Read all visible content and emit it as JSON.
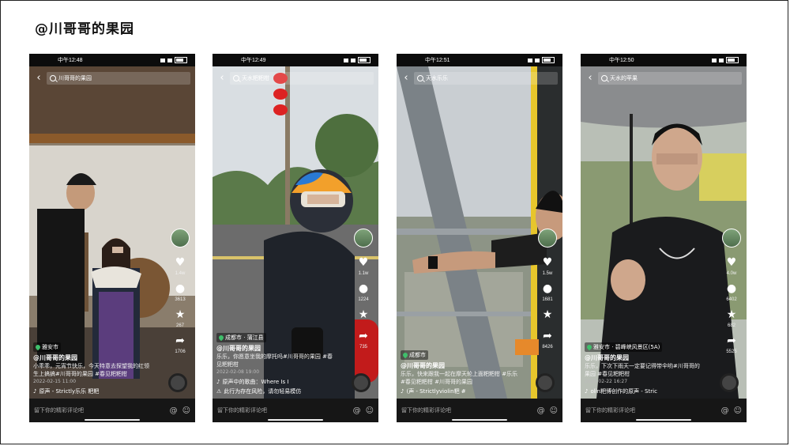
{
  "slide": {
    "title": "@川哥哥的果园"
  },
  "phones": [
    {
      "time": "中午12:48",
      "search": "川哥哥的果园",
      "sidebar": {
        "likes": "1.4w",
        "comments": "3613",
        "favorites": "267",
        "shares": "1706"
      },
      "location": "雅安市",
      "author": "@川哥哥的果园",
      "caption": "小乖乖，元宵节快乐，今天特意去探望我的红领生上搞搞#川哥哥的果园 #春见粑粑柑",
      "date": "2022-02-15 11:00",
      "music_note": "",
      "music": "原声 - Strictly乐乐 粑粑",
      "comment_placeholder": "留下你的精彩评论吧"
    },
    {
      "time": "中午12:49",
      "search": "天水粑粑柑",
      "sidebar": {
        "likes": "1.1w",
        "comments": "1224",
        "favorites": "",
        "shares": "735"
      },
      "location": "成都市 · 蒲江县",
      "author": "@川哥哥的果园",
      "caption": "乐乐，你愿意坐我的摩托吗#川哥哥的果园 #春见粑粑柑",
      "date": "2022-02-08 19:00",
      "music_note": "原声中的歌曲：Where Is I",
      "music": "此行为存在风险，请勿轻易模仿",
      "comment_placeholder": "留下你的精彩评论吧"
    },
    {
      "time": "中午12:51",
      "search": "天水乐乐",
      "sidebar": {
        "likes": "1.5w",
        "comments": "1681",
        "favorites": "",
        "shares": "8426"
      },
      "location": "成都市",
      "author": "@川哥哥的果园",
      "caption": "乐乐，快来跟我一起在摩天轮上面粑粑柑 #乐乐 #春见粑粑柑 #川哥哥的果园",
      "date": "",
      "music_note": "",
      "music": "(声 - Strictlyviolin粑 #",
      "comment_placeholder": "留下你的精彩评论吧"
    },
    {
      "time": "中午12:50",
      "search": "天水的苹果",
      "sidebar": {
        "likes": "4.0w",
        "comments": "6402",
        "favorites": "682",
        "shares": "5525"
      },
      "location": "雅安市 · 碧峰峡风景区(5A)",
      "author": "@川哥哥的果园",
      "caption": "乐乐，下次下雨天一定要记得带伞哟#川哥哥的果园 #春见粑粑柑",
      "date": "2022-02-22 16:27",
      "music_note": "",
      "music": "olin粑博创作的原声 - Stric",
      "comment_placeholder": "留下你的精彩评论吧"
    }
  ]
}
